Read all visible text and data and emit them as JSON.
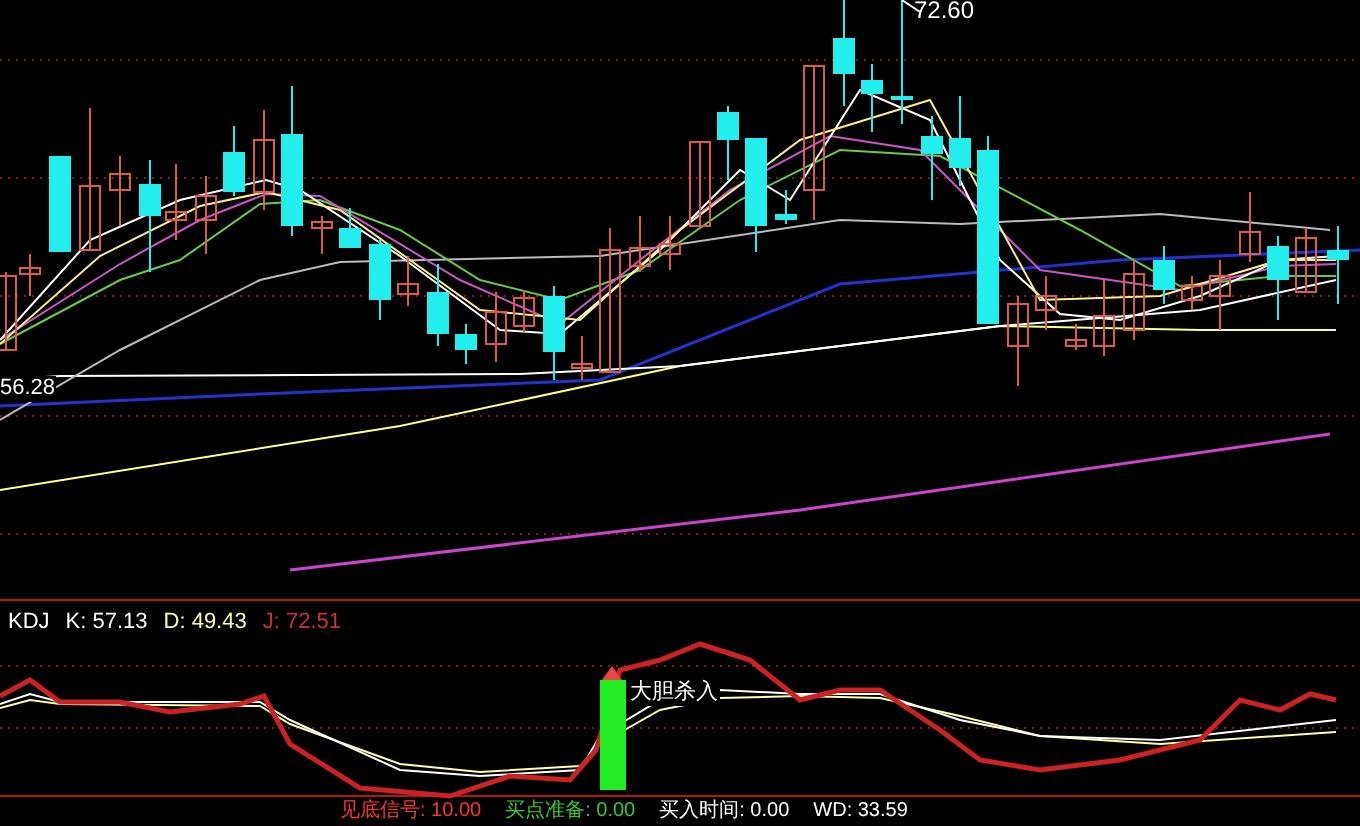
{
  "main_chart": {
    "high_label": "72.60",
    "low_label": "56.28"
  },
  "indicator": {
    "name": "KDJ",
    "values": [
      {
        "text": "K: 57.13",
        "color": "#ffffff"
      },
      {
        "text": "D: 49.43",
        "color": "#ffffaa"
      },
      {
        "text": "J: 72.51",
        "color": "#cc3333"
      }
    ],
    "signal_label": "大胆杀入"
  },
  "status_items": [
    {
      "text": "见底信号: 10.00",
      "color": "#ff3333"
    },
    {
      "text": "买点准备: 0.00",
      "color": "#33cc33"
    },
    {
      "text": "买入时间: 0.00",
      "color": "#ffffff"
    },
    {
      "text": "WD: 33.59",
      "color": "#ffffff"
    }
  ]
}
